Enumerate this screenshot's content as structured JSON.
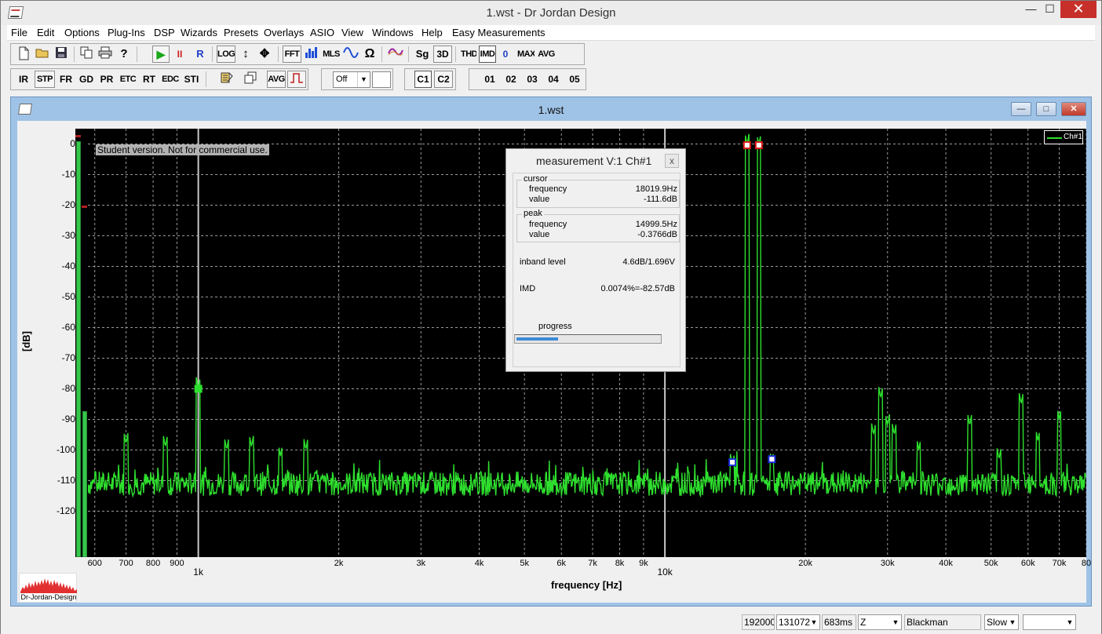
{
  "app": {
    "title": "1.wst - Dr Jordan Design",
    "window_controls": {
      "minimize": "—",
      "maximize": "☐",
      "close": "✕"
    }
  },
  "menu": [
    "File",
    "Edit",
    "Options",
    "Plug-Ins",
    "DSP",
    "Wizards",
    "Presets",
    "Overlays",
    "ASIO",
    "View",
    "Windows",
    "Help",
    "Easy Measurements"
  ],
  "toolbar1": {
    "icons": [
      "new-file-icon",
      "open-folder-icon",
      "save-icon",
      "copy-icon",
      "print-icon",
      "help-icon"
    ],
    "transport": {
      "play": "▶",
      "pause": "II",
      "record": "R"
    },
    "view_buttons": [
      "LOG",
      "↕",
      "✥"
    ],
    "analysis_buttons": [
      "FFT",
      "MLS",
      "Ω",
      "Sg",
      "3D",
      "THD",
      "IMD",
      "0",
      "MAX",
      "AVG"
    ]
  },
  "toolbar2": {
    "buttons": [
      "IR",
      "STP",
      "FR",
      "GD",
      "PR",
      "ETC",
      "RT",
      "EDC",
      "STI"
    ],
    "avg_label": "AVG",
    "select_value": "Off",
    "channels": [
      "C1",
      "C2"
    ],
    "overlays": [
      "01",
      "02",
      "03",
      "04",
      "05"
    ]
  },
  "child_window": {
    "title": "1.wst",
    "controls": {
      "minimize": "—",
      "maximize": "□",
      "close": "✕"
    }
  },
  "plot": {
    "student_notice": "Student version. Not for commercial use.",
    "legend": "Ch#1",
    "colors": {
      "trace": "#2ee02e",
      "background": "#000000",
      "grid": "#9a9a9a",
      "cursor": "#c8c8c8",
      "peak_marker": "#e01818",
      "sideband_marker": "#1a2bd8"
    }
  },
  "meter": {
    "left_level": 0.97,
    "right_level": 0.34
  },
  "logo": {
    "text": "Dr-Jordan-Design"
  },
  "chart_data": {
    "type": "line",
    "xlabel": "frequency [Hz]",
    "ylabel": "[dB]",
    "xscale": "log",
    "xlim": [
      580,
      80000
    ],
    "ylim": [
      -135,
      5
    ],
    "grid": true,
    "legend_position": "top-right",
    "yticks": [
      "0",
      "-10",
      "-20",
      "-30",
      "-40",
      "-50",
      "-60",
      "-70",
      "-80",
      "-90",
      "-100",
      "-110",
      "-120"
    ],
    "ytick_values": [
      0,
      -10,
      -20,
      -30,
      -40,
      -50,
      -60,
      -70,
      -80,
      -90,
      -100,
      -110,
      -120
    ],
    "xticks": [
      {
        "label": "600",
        "value": 600,
        "major": false
      },
      {
        "label": "700",
        "value": 700,
        "major": false
      },
      {
        "label": "800",
        "value": 800,
        "major": false
      },
      {
        "label": "900",
        "value": 900,
        "major": false
      },
      {
        "label": "1k",
        "value": 1000,
        "major": true
      },
      {
        "label": "2k",
        "value": 2000,
        "major": false
      },
      {
        "label": "3k",
        "value": 3000,
        "major": false
      },
      {
        "label": "4k",
        "value": 4000,
        "major": false
      },
      {
        "label": "5k",
        "value": 5000,
        "major": false
      },
      {
        "label": "6k",
        "value": 6000,
        "major": false
      },
      {
        "label": "7k",
        "value": 7000,
        "major": false
      },
      {
        "label": "8k",
        "value": 8000,
        "major": false
      },
      {
        "label": "9k",
        "value": 9000,
        "major": false
      },
      {
        "label": "10k",
        "value": 10000,
        "major": true
      },
      {
        "label": "20k",
        "value": 20000,
        "major": false
      },
      {
        "label": "30k",
        "value": 30000,
        "major": false
      },
      {
        "label": "40k",
        "value": 40000,
        "major": false
      },
      {
        "label": "50k",
        "value": 50000,
        "major": false
      },
      {
        "label": "60k",
        "value": 60000,
        "major": false
      },
      {
        "label": "70k",
        "value": 70000,
        "major": false
      },
      {
        "label": "80",
        "value": 80000,
        "major": false
      }
    ],
    "series": [
      {
        "name": "Ch#1",
        "noise_floor_db": -111,
        "peaks": [
          {
            "freq": 700,
            "db": -98
          },
          {
            "freq": 850,
            "db": -99
          },
          {
            "freq": 1000,
            "db": -80
          },
          {
            "freq": 1150,
            "db": -100
          },
          {
            "freq": 1300,
            "db": -99
          },
          {
            "freq": 1500,
            "db": -102
          },
          {
            "freq": 1700,
            "db": -100
          },
          {
            "freq": 13950,
            "db": -105
          },
          {
            "freq": 14999.5,
            "db": -0.4
          },
          {
            "freq": 15900,
            "db": -0.4
          },
          {
            "freq": 16950,
            "db": -104
          },
          {
            "freq": 28000,
            "db": -95
          },
          {
            "freq": 29000,
            "db": -83
          },
          {
            "freq": 30000,
            "db": -92
          },
          {
            "freq": 31000,
            "db": -95
          },
          {
            "freq": 35000,
            "db": -100
          },
          {
            "freq": 45000,
            "db": -92
          },
          {
            "freq": 52000,
            "db": -103
          },
          {
            "freq": 58000,
            "db": -85
          },
          {
            "freq": 63000,
            "db": -97
          },
          {
            "freq": 70000,
            "db": -90
          }
        ]
      }
    ],
    "cursor_lines_hz": [
      1000,
      10000
    ],
    "markers": [
      {
        "kind": "reference",
        "freq": 1000,
        "db": -80
      },
      {
        "kind": "peak",
        "freq": 14999.5,
        "db": -0.4
      },
      {
        "kind": "peak",
        "freq": 15900,
        "db": -0.4
      },
      {
        "kind": "sideband",
        "freq": 13950,
        "db": -104
      },
      {
        "kind": "sideband",
        "freq": 16950,
        "db": -103
      }
    ]
  },
  "measurement": {
    "title": "measurement V:1 Ch#1",
    "close": "x",
    "cursor": {
      "label": "cursor",
      "frequency_label": "frequency",
      "frequency": "18019.9Hz",
      "value_label": "value",
      "value": "-111.6dB"
    },
    "peak": {
      "label": "peak",
      "frequency_label": "frequency",
      "frequency": "14999.5Hz",
      "value_label": "value",
      "value": "-0.3766dB"
    },
    "inband_label": "inband level",
    "inband_value": "4.6dB/1.696V",
    "imd_label": "IMD",
    "imd_value": "0.0074%=-82.57dB",
    "progress_label": "progress",
    "progress": 0.29
  },
  "statusbar": {
    "sample_rate": "192000",
    "fft_size": "131072",
    "time": "683ms",
    "weighting": "Z",
    "window": "Blackman",
    "speed": "Slow",
    "extra": ""
  }
}
